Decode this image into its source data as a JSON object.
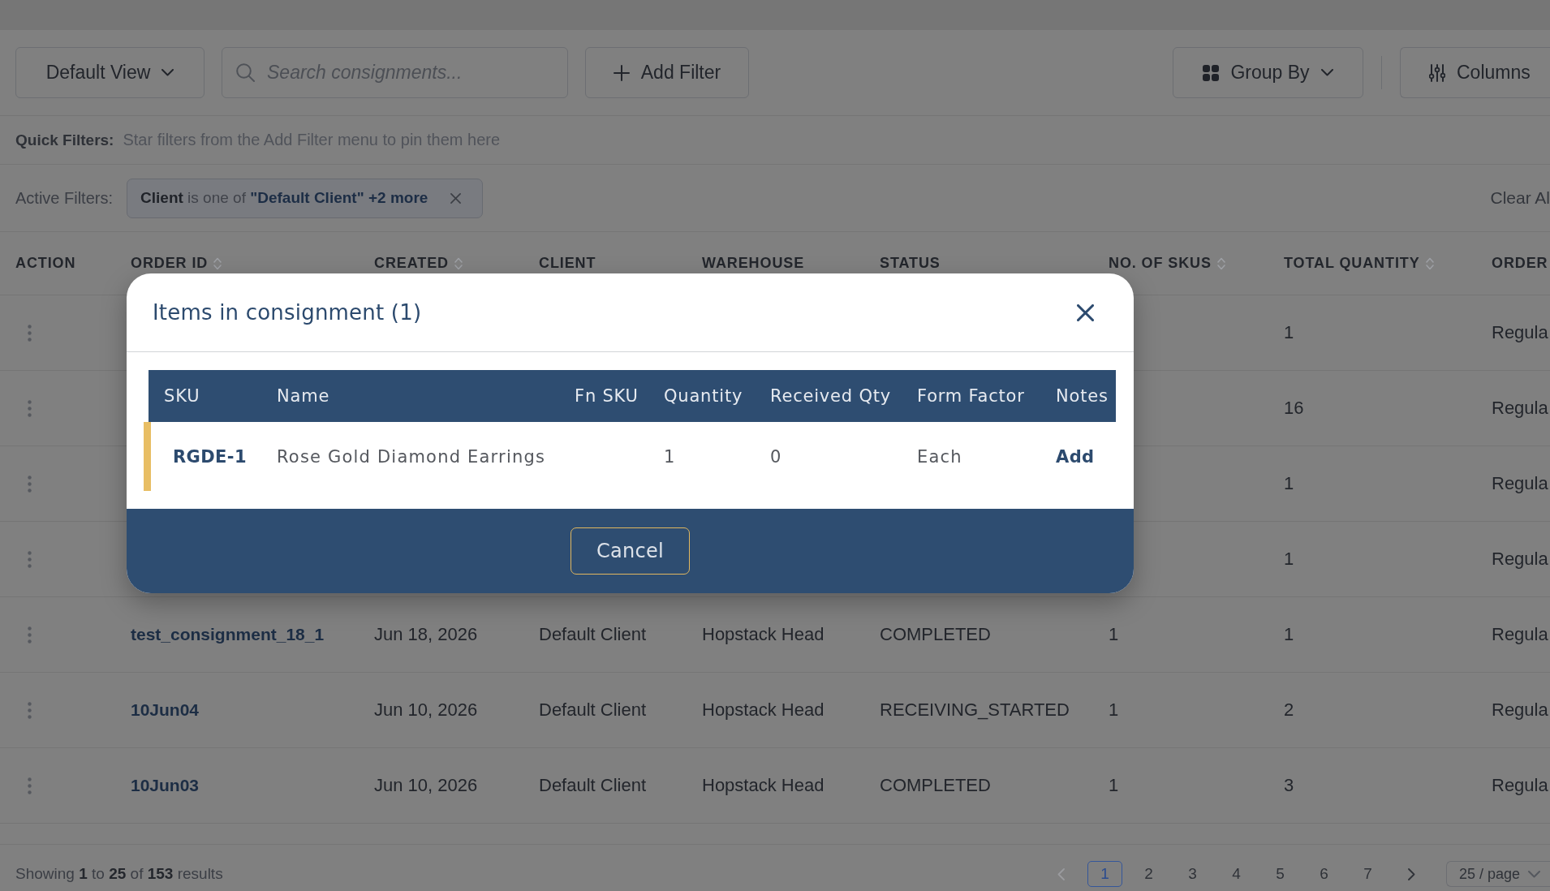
{
  "toolbar": {
    "view_select": {
      "label": "Default View"
    },
    "search": {
      "placeholder": "Search consignments..."
    },
    "add_filter": {
      "label": "Add Filter"
    },
    "group_by": {
      "label": "Group By"
    },
    "columns": {
      "label": "Columns"
    }
  },
  "quick_filters": {
    "label": "Quick Filters:",
    "hint": "Star filters from the Add Filter menu to pin them here"
  },
  "active_filters": {
    "label": "Active Filters:",
    "chips": [
      {
        "field": "Client",
        "operator": "is one of",
        "value": "\"Default Client\" +2 more"
      }
    ],
    "clear_all": "Clear Al"
  },
  "table": {
    "columns": [
      {
        "label": "ACTION",
        "sortable": false
      },
      {
        "label": "ORDER ID",
        "sortable": true
      },
      {
        "label": "CREATED",
        "sortable": true
      },
      {
        "label": "CLIENT",
        "sortable": false
      },
      {
        "label": "WAREHOUSE",
        "sortable": false
      },
      {
        "label": "STATUS",
        "sortable": false
      },
      {
        "label": "NO. OF SKUS",
        "sortable": true
      },
      {
        "label": "TOTAL QUANTITY",
        "sortable": true
      },
      {
        "label": "ORDER",
        "sortable": false
      }
    ],
    "rows": [
      {
        "total_quantity": "1",
        "column_9": "Regula"
      },
      {
        "total_quantity": "16",
        "column_9": "Regula"
      },
      {
        "total_quantity": "1",
        "column_9": "Regula"
      },
      {
        "total_quantity": "1",
        "column_9": "Regula"
      },
      {
        "order_id": "test_consignment_18_1",
        "created": "Jun 18, 2026",
        "client": "Default Client",
        "warehouse": "Hopstack Head",
        "status": "COMPLETED",
        "no_of_skus": "1",
        "total_quantity": "1",
        "column_9": "Regula"
      },
      {
        "order_id": "10Jun04",
        "created": "Jun 10, 2026",
        "client": "Default Client",
        "warehouse": "Hopstack Head",
        "status": "RECEIVING_STARTED",
        "no_of_skus": "1",
        "total_quantity": "2",
        "column_9": "Regula"
      },
      {
        "order_id": "10Jun03",
        "created": "Jun 10, 2026",
        "client": "Default Client",
        "warehouse": "Hopstack Head",
        "status": "COMPLETED",
        "no_of_skus": "1",
        "total_quantity": "3",
        "column_9": "Regula"
      }
    ]
  },
  "footer": {
    "summary": "Showing **1** to **25** of **153** results",
    "pagination": {
      "previous": {
        "disabled": true
      },
      "pages": [
        {
          "label": "1",
          "selected": true
        },
        {
          "label": "2",
          "selected": false
        },
        {
          "label": "3",
          "selected": false
        },
        {
          "label": "4",
          "selected": false
        },
        {
          "label": "5",
          "selected": false
        },
        {
          "label": "6",
          "selected": false
        },
        {
          "label": "7",
          "selected": false
        }
      ],
      "next": {
        "disabled": false
      }
    },
    "page_size": "25 / page"
  },
  "modal": {
    "title": "Items in consignment (1)",
    "columns": [
      "SKU",
      "Name",
      "Fn SKU",
      "Quantity",
      "Received Qty",
      "Form Factor",
      "Notes"
    ],
    "items": [
      {
        "sku": "RGDE-1",
        "name": "Rose Gold Diamond Earrings",
        "quantity": "1",
        "received_qty": "0",
        "form_factor": "Each",
        "notes": "Add",
        "color": "#e8be64"
      }
    ],
    "cancel": "Cancel"
  }
}
